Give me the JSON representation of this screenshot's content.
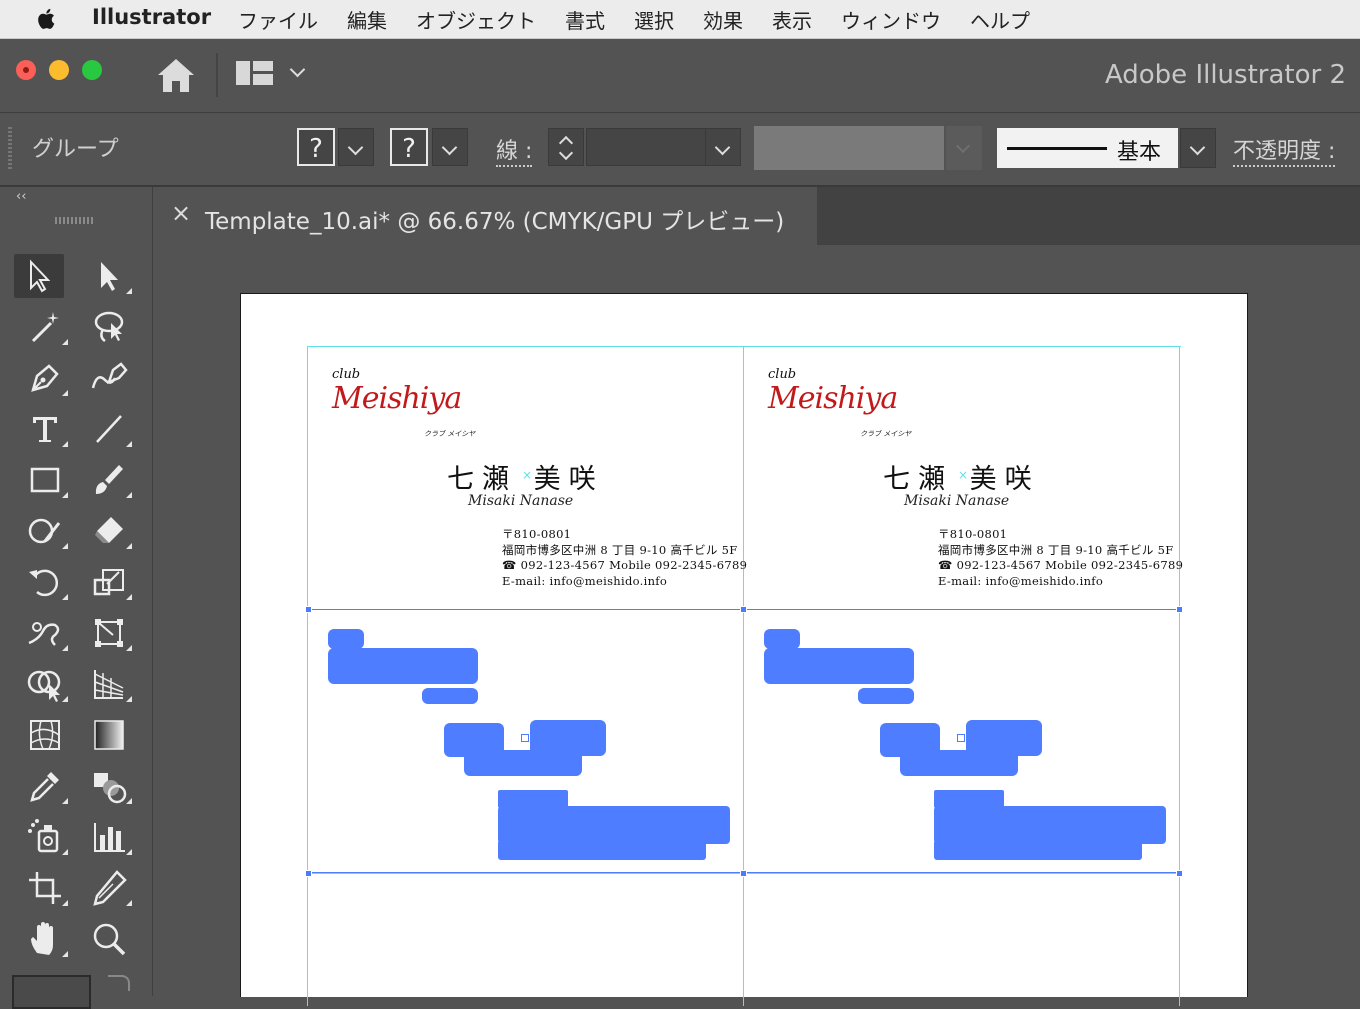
{
  "menubar": {
    "app_name": "Illustrator",
    "menus": [
      "ファイル",
      "編集",
      "オブジェクト",
      "書式",
      "選択",
      "効果",
      "表示",
      "ウィンドウ",
      "ヘルプ"
    ]
  },
  "appbar": {
    "title": "Adobe Illustrator 2"
  },
  "control": {
    "selection_label": "グループ",
    "fill_unknown": "?",
    "stroke_unknown": "?",
    "stroke_label": "線 :",
    "brush_label": "基本",
    "opacity_label": "不透明度 :"
  },
  "tab": {
    "close": "×",
    "title": "Template_10.ai* @ 66.67% (CMYK/GPU プレビュー)"
  },
  "toolbar": {
    "collapse": "‹‹"
  },
  "cards": [
    {
      "club": "club",
      "logo": "Meishiya",
      "logo_kana": "クラブ メイシヤ",
      "name": "七瀬 美咲",
      "roman": "Misaki Nanase",
      "address": [
        "〒810-0801",
        "福岡市博多区中洲 8 丁目 9-10 高千ビル 5F",
        "☎ 092-123-4567  Mobile 092-2345-6789",
        "E-mail: info@meishido.info"
      ]
    },
    {
      "club": "club",
      "logo": "Meishiya",
      "logo_kana": "クラブ メイシヤ",
      "name": "七瀬 美咲",
      "roman": "Misaki Nanase",
      "address": [
        "〒810-0801",
        "福岡市博多区中洲 8 丁目 9-10 高千ビル 5F",
        "☎ 092-123-4567  Mobile 092-2345-6789",
        "E-mail: info@meishido.info"
      ]
    }
  ],
  "colors": {
    "accent_selection": "#4f7dff",
    "guide": "#5fe0ea",
    "logo_red": "#c21a1a"
  }
}
